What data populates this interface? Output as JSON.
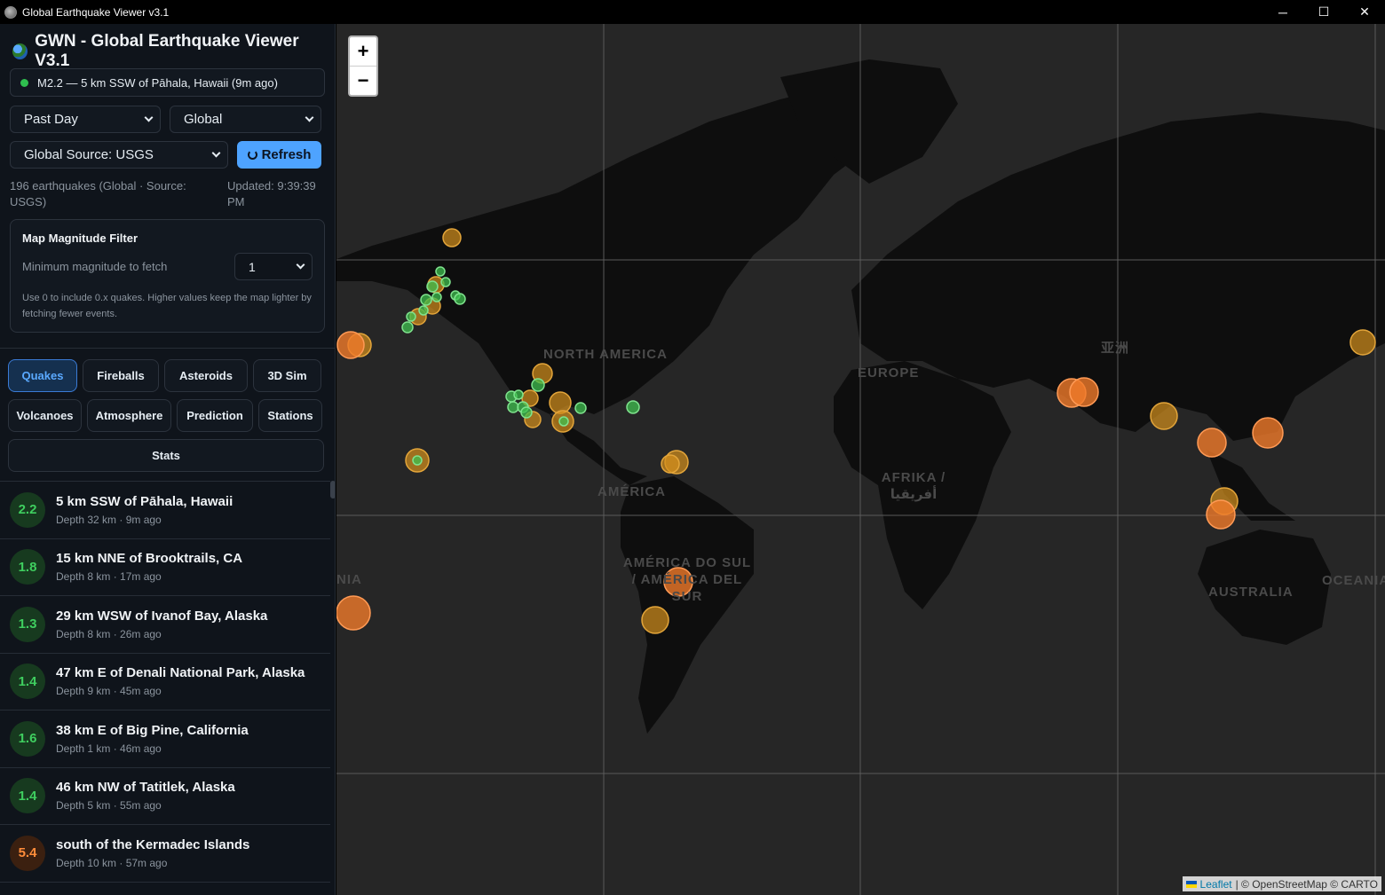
{
  "window": {
    "title": "Global Earthquake Viewer v3.1",
    "minimize": "─",
    "maximize": "☐",
    "close": "✕"
  },
  "header": {
    "title": "GWN - Global Earthquake Viewer V3.1",
    "latest": "M2.2 — 5 km SSW of Pāhala, Hawaii (9m ago)"
  },
  "controls": {
    "period": "Past Day",
    "region": "Global",
    "source": "Global Source: USGS",
    "refresh": "Refresh"
  },
  "status": {
    "count": "196 earthquakes (Global · Source: USGS)",
    "updated": "Updated: 9:39:39 PM"
  },
  "filter": {
    "title": "Map Magnitude Filter",
    "label": "Minimum magnitude to fetch",
    "value": "1",
    "note": "Use 0 to include 0.x quakes. Higher values keep the map lighter by fetching fewer events."
  },
  "tabs": {
    "quakes": "Quakes",
    "fireballs": "Fireballs",
    "asteroids": "Asteroids",
    "sim3d": "3D Sim",
    "volcanoes": "Volcanoes",
    "atmosphere": "Atmosphere",
    "prediction": "Prediction",
    "stations": "Stations",
    "stats": "Stats"
  },
  "quakes": [
    {
      "mag": "2.2",
      "place": "5 km SSW of Pāhala, Hawaii",
      "meta": "Depth 32 km · 9m ago",
      "level": "low"
    },
    {
      "mag": "1.8",
      "place": "15 km NNE of Brooktrails, CA",
      "meta": "Depth 8 km · 17m ago",
      "level": "low"
    },
    {
      "mag": "1.3",
      "place": "29 km WSW of Ivanof Bay, Alaska",
      "meta": "Depth 8 km · 26m ago",
      "level": "low"
    },
    {
      "mag": "1.4",
      "place": "47 km E of Denali National Park, Alaska",
      "meta": "Depth 9 km · 45m ago",
      "level": "low"
    },
    {
      "mag": "1.6",
      "place": "38 km E of Big Pine, California",
      "meta": "Depth 1 km · 46m ago",
      "level": "low"
    },
    {
      "mag": "1.4",
      "place": "46 km NW of Tatitlek, Alaska",
      "meta": "Depth 5 km · 55m ago",
      "level": "low"
    },
    {
      "mag": "5.4",
      "place": "south of the Kermadec Islands",
      "meta": "Depth 10 km · 57m ago",
      "level": "high"
    }
  ],
  "map": {
    "zoom_in": "+",
    "zoom_out": "−",
    "labels": {
      "north_america": "NORTH AMERICA",
      "europe": "EUROPE",
      "asia": "亚洲",
      "africa": "AFRIKA / أفريقيا",
      "america": "AMÉRICA",
      "south_america": "AMÉRICA DO SUL / AMÉRICA DEL SUR",
      "australia": "AUSTRALIA",
      "oceania": "OCEANIA",
      "nia": "NIA"
    },
    "attribution_leaflet": "Leaflet",
    "attribution_rest": "| © OpenStreetMap © CARTO",
    "colors": {
      "minor": "#3fbf4f",
      "moderate": "#d4901c",
      "strong": "#f07a2a"
    }
  }
}
